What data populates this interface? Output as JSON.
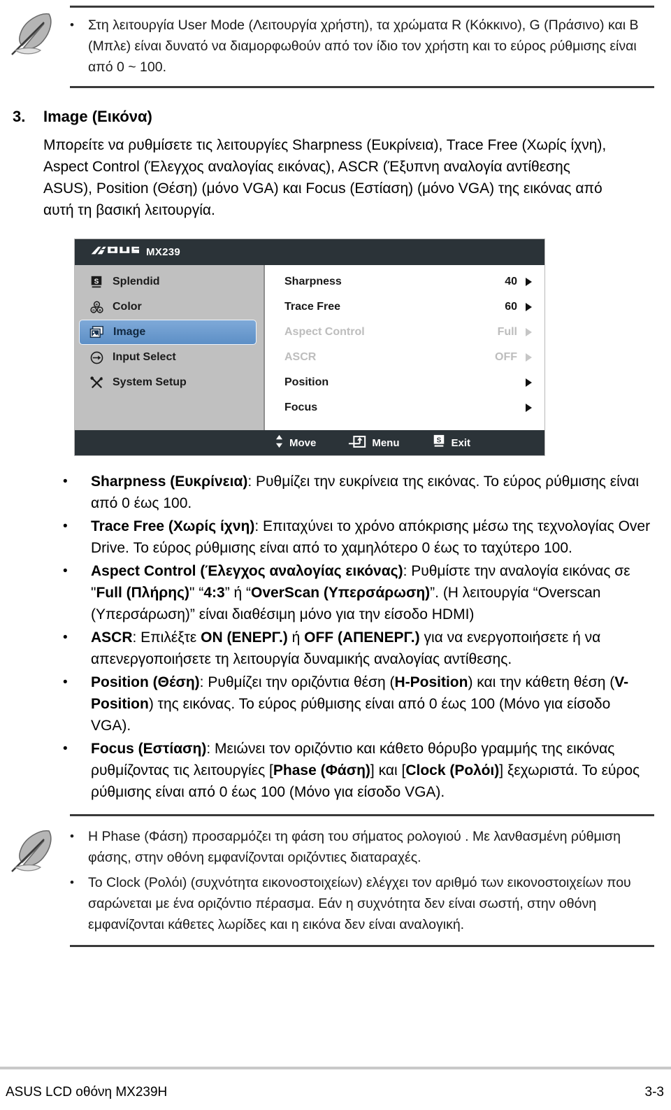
{
  "note_top": {
    "icon": "quill-feather-icon",
    "items": [
      "Στη λειτουργία User Mode (Λειτουργία χρήστη), τα χρώματα R (Κόκκινο), G (Πράσινο) και B (Μπλε) είναι δυνατό να διαμορφωθούν από τον ίδιο τον χρήστη και το εύρος ρύθμισης είναι από 0 ~ 100."
    ]
  },
  "section": {
    "number": "3.",
    "title": "Image (Εικόνα)",
    "paragraph": "Μπορείτε να ρυθμίσετε τις λειτουργίες Sharpness (Ευκρίνεια), Trace Free (Χωρίς ίχνη), Aspect Control (Έλεγχος αναλογίας εικόνας), ASCR (Έξυπνη αναλογία αντίθεσης ASUS), Position (Θέση) (μόνο VGA) και Focus (Εστίαση) (μόνο VGA) της εικόνας από αυτή τη βασική λειτουργία."
  },
  "osd": {
    "brand": "ASUS",
    "model": "MX239",
    "colors": {
      "titlebar": "#2b3338",
      "sidebar": "#c0c0c0",
      "highlight": "#5d8fc6",
      "panel": "#ffffff",
      "dim_text": "#bdbdbd"
    },
    "sidebar": [
      {
        "label": "Splendid",
        "icon": "splendid-s-icon",
        "selected": false
      },
      {
        "label": "Color",
        "icon": "color-rgb-icon",
        "selected": false
      },
      {
        "label": "Image",
        "icon": "image-picture-icon",
        "selected": true
      },
      {
        "label": "Input Select",
        "icon": "input-arrow-icon",
        "selected": false
      },
      {
        "label": "System Setup",
        "icon": "tools-icon",
        "selected": false
      }
    ],
    "items": [
      {
        "label": "Sharpness",
        "value": "40",
        "dim": false,
        "arrow": true
      },
      {
        "label": "Trace Free",
        "value": "60",
        "dim": false,
        "arrow": true
      },
      {
        "label": "Aspect Control",
        "value": "Full",
        "dim": true,
        "arrow": true
      },
      {
        "label": "ASCR",
        "value": "OFF",
        "dim": true,
        "arrow": true
      },
      {
        "label": "Position",
        "value": "",
        "dim": false,
        "arrow": true
      },
      {
        "label": "Focus",
        "value": "",
        "dim": false,
        "arrow": true
      }
    ],
    "footer": [
      {
        "label": "Move",
        "icon": "up-down-arrows-icon"
      },
      {
        "label": "Menu",
        "icon": "menu-enter-icon"
      },
      {
        "label": "Exit",
        "icon": "splendid-s-icon"
      }
    ]
  },
  "bullets": [
    {
      "term": "Sharpness (Ευκρίνεια)",
      "rest": ": Ρυθμίζει την ευκρίνεια της εικόνας. Το εύρος ρύθμισης είναι από 0 έως 100."
    },
    {
      "term": "Trace Free (Χωρίς ίχνη)",
      "rest": ": Επιταχύνει το χρόνο απόκρισης μέσω της τεχνολογίας Over Drive. Το εύρος ρύθμισης είναι από το χαμηλότερο 0 έως το ταχύτερο 100."
    },
    {
      "term": "Aspect Control (Έλεγχος αναλογίας εικόνας)",
      "rest": ": Ρυθμίστε την αναλογία εικόνας σε \"Full (Πλήρης)\" “4:3” ή “OverScan (Υπερσάρωση)”. (Η λειτουργία “Overscan (Υπερσάρωση)” είναι διαθέσιμη μόνο για την είσοδο HDMI)",
      "bold_parts": [
        "Full (Πλήρης)",
        "4:3",
        "OverScan (Υπερσάρωση)"
      ]
    },
    {
      "term": "ASCR",
      "rest": ": Επιλέξτε ON (ΕΝΕΡΓ.) ή OFF (ΑΠΕΝΕΡΓ.) για να ενεργοποιήσετε ή να απενεργοποιήσετε τη λειτουργία δυναμικής αναλογίας αντίθεσης.",
      "bold_parts": [
        "ON (ΕΝΕΡΓ.)",
        "OFF (ΑΠΕΝΕΡΓ.)"
      ]
    },
    {
      "term": "Position (Θέση)",
      "rest": ": Ρυθμίζει την οριζόντια θέση (H-Position) και την κάθετη θέση (V-Position) της εικόνας. Το εύρος ρύθμισης είναι από 0 έως 100 (Μόνο για είσοδο VGA).",
      "bold_parts": [
        "H-Position",
        "V-Position"
      ]
    },
    {
      "term": "Focus (Εστίαση)",
      "rest": ": Μειώνει τον οριζόντιο και κάθετο θόρυβο γραμμής της εικόνας ρυθμίζοντας τις λειτουργίες [Phase (Φάση)] και [Clock (Ρολόι)] ξεχωριστά. Το εύρος ρύθμισης είναι από 0 έως 100 (Μόνο για είσοδο VGA).",
      "bold_parts": [
        "Phase (Φάση)",
        "Clock (Ρολόι)"
      ]
    }
  ],
  "note_bottom": {
    "icon": "quill-feather-icon",
    "items": [
      "Η Phase (Φάση) προσαρμόζει τη φάση του σήματος ρολογιού . Με λανθασμένη ρύθμιση φάσης, στην οθόνη εμφανίζονται οριζόντιες διαταραχές.",
      "Το Clock (Ρολόι) (συχνότητα εικονοστοιχείων) ελέγχει τον αριθμό των εικονοστοιχείων που σαρώνεται με ένα οριζόντιο πέρασμα. Εάν η συχνότητα δεν είναι σωστή, στην οθόνη εμφανίζονται κάθετες λωρίδες και η εικόνα δεν είναι αναλογική."
    ]
  },
  "footer": {
    "left": "ASUS LCD οθόνη MX239H",
    "right": "3-3"
  },
  "bullet_glyph": "•"
}
